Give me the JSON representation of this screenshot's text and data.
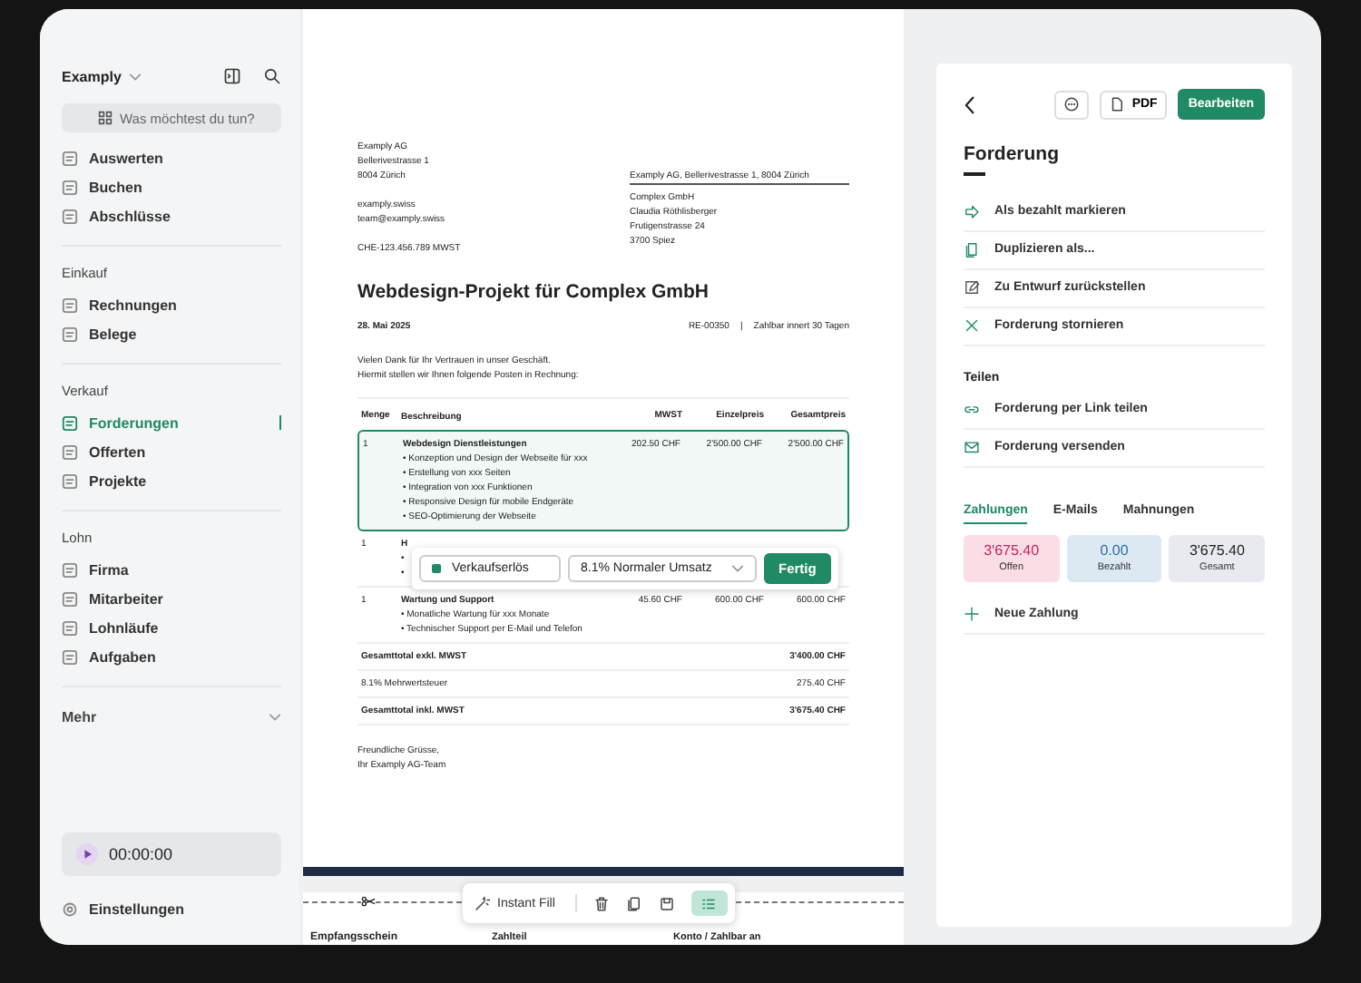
{
  "sidebar": {
    "company": "Examply",
    "search": {
      "placeholder": "Was möchtest du tun?"
    },
    "sections": [
      {
        "items": [
          {
            "label": "Auswerten",
            "selected": false
          },
          {
            "label": "Buchen",
            "selected": false
          },
          {
            "label": "Abschlüsse",
            "selected": false
          }
        ]
      },
      {
        "heading": "Einkauf",
        "items": [
          {
            "label": "Rechnungen",
            "selected": false
          },
          {
            "label": "Belege",
            "selected": false
          }
        ]
      },
      {
        "heading": "Verkauf",
        "items": [
          {
            "label": "Forderungen",
            "selected": true
          },
          {
            "label": "Offerten",
            "selected": false
          },
          {
            "label": "Projekte",
            "selected": false
          }
        ]
      },
      {
        "heading": "Lohn",
        "items": [
          {
            "label": "Firma",
            "selected": false
          },
          {
            "label": "Mitarbeiter",
            "selected": false
          },
          {
            "label": "Lohnläufe",
            "selected": false
          },
          {
            "label": "Aufgaben",
            "selected": false
          }
        ]
      }
    ],
    "more": {
      "label": "Mehr",
      "expanded": false
    },
    "timer": "00:00:00",
    "settings": "Einstellungen"
  },
  "document": {
    "sender": [
      "Examply AG",
      "Bellerivestrasse 1",
      "8004 Zürich"
    ],
    "contact": [
      "examply.swiss",
      "team@examply.swiss"
    ],
    "vat_number": "CHE-123.456.789 MWST",
    "return_address": "Examply AG, Bellerivestrasse 1, 8004 Zürich",
    "recipient": [
      "Complex GmbH",
      "Claudia Röthlisberger",
      "Frutigenstrasse 24",
      "3700 Spiez"
    ],
    "title": "Webdesign-Projekt für Complex GmbH",
    "date": "28. Mai 2025",
    "number": "RE-00350",
    "separator": "|",
    "terms": "Zahlbar innert 30 Tagen",
    "intro": [
      "Vielen Dank für Ihr Vertrauen in unser Geschäft.",
      "Hiermit stellen wir Ihnen folgende Posten in Rechnung:"
    ],
    "columns": [
      "Menge",
      "Beschreibung",
      "MWST",
      "Einzelpreis",
      "Gesamtpreis"
    ],
    "rows": [
      {
        "qty": "1",
        "title": "Webdesign Dienstleistungen",
        "bullets": [
          "• Konzeption und Design der Webseite für xxx",
          "• Erstellung von xxx Seiten",
          "• Integration von xxx Funktionen",
          "• Responsive Design für mobile Endgeräte",
          "• SEO-Optimierung der Webseite"
        ],
        "vat": "202.50 CHF",
        "unit": "2'500.00 CHF",
        "total": "2'500.00 CHF",
        "selected": true
      },
      {
        "qty": "1",
        "title": "H",
        "bullets": [
          "•",
          "•"
        ],
        "selected": false,
        "editor": {
          "account": {
            "label": "Verkaufserlös",
            "color": "#1f8a63"
          },
          "tax": "8.1% Normaler Umsatz",
          "button": "Fertig"
        }
      },
      {
        "qty": "1",
        "title": "Wartung und Support",
        "bullets": [
          "• Monatliche Wartung für xxx Monate",
          "• Technischer Support per E-Mail und Telefon"
        ],
        "vat": "45.60 CHF",
        "unit": "600.00 CHF",
        "total": "600.00 CHF",
        "selected": false
      }
    ],
    "totals": [
      {
        "label": "Gesamttotal exkl. MWST",
        "value": "3'400.00 CHF",
        "bold": true
      },
      {
        "label": "8.1% Mehrwertsteuer",
        "value": "275.40 CHF",
        "bold": false
      },
      {
        "label": "Gesamttotal inkl. MWST",
        "value": "3'675.40 CHF",
        "bold": true
      }
    ],
    "closing": [
      "Freundliche Grüsse,",
      "Ihr Examply AG-Team"
    ],
    "receipt": {
      "left": "Empfangsschein",
      "middle": "Zahlteil",
      "right": "Konto / Zahlbar an"
    }
  },
  "toolbar": {
    "instant_fill": "Instant Fill",
    "list_view": {
      "selected": true
    }
  },
  "panel": {
    "pdf": "PDF",
    "edit": "Bearbeiten",
    "title": "Forderung",
    "actions": [
      "Als bezahlt markieren",
      "Duplizieren als...",
      "Zu Entwurf zurückstellen",
      "Forderung stornieren"
    ],
    "share_heading": "Teilen",
    "share": [
      "Forderung per Link teilen",
      "Forderung versenden"
    ],
    "tabs": [
      {
        "label": "Zahlungen",
        "selected": true
      },
      {
        "label": "E-Mails",
        "selected": false
      },
      {
        "label": "Mahnungen",
        "selected": false
      }
    ],
    "stats": [
      {
        "value": "3'675.40",
        "label": "Offen",
        "kind": "open"
      },
      {
        "value": "0.00",
        "label": "Bezahlt",
        "kind": "paid"
      },
      {
        "value": "3'675.40",
        "label": "Gesamt",
        "kind": "total"
      }
    ],
    "new_payment": "Neue Zahlung"
  }
}
